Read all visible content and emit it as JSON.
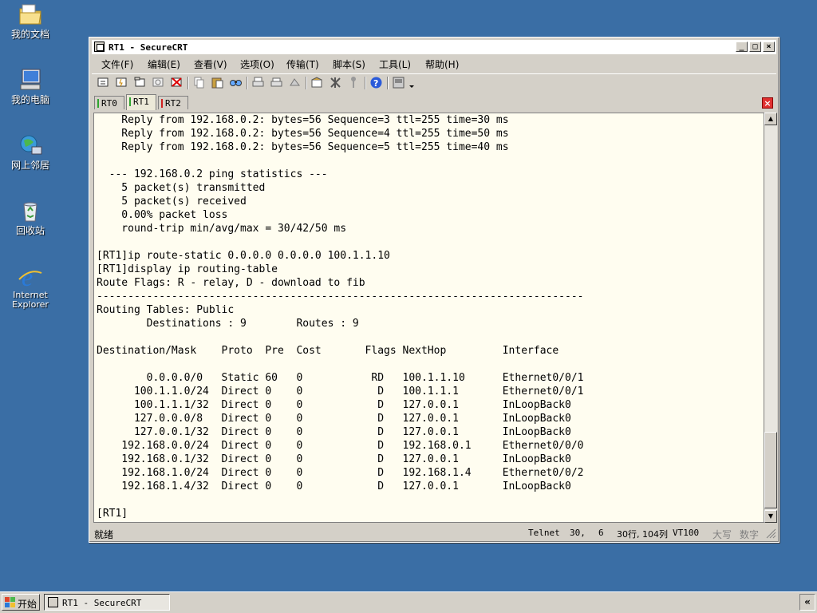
{
  "desktop": {
    "icons": [
      {
        "label": "我的文档"
      },
      {
        "label": "我的电脑"
      },
      {
        "label": "网上邻居"
      },
      {
        "label": "回收站"
      },
      {
        "label": "Internet Explorer"
      }
    ]
  },
  "window": {
    "title": "RT1 - SecureCRT",
    "menu": [
      "文件(F)",
      "编辑(E)",
      "查看(V)",
      "选项(O)",
      "传输(T)",
      "脚本(S)",
      "工具(L)",
      "帮助(H)"
    ],
    "tabs": [
      {
        "label": "RT0",
        "color": "#2fa52f"
      },
      {
        "label": "RT1",
        "color": "#2fa52f"
      },
      {
        "label": "RT2",
        "color": "#d02020"
      }
    ],
    "active_tab": "RT1",
    "terminal_lines": [
      "    Reply from 192.168.0.2: bytes=56 Sequence=3 ttl=255 time=30 ms",
      "    Reply from 192.168.0.2: bytes=56 Sequence=4 ttl=255 time=50 ms",
      "    Reply from 192.168.0.2: bytes=56 Sequence=5 ttl=255 time=40 ms",
      "",
      "  --- 192.168.0.2 ping statistics ---",
      "    5 packet(s) transmitted",
      "    5 packet(s) received",
      "    0.00% packet loss",
      "    round-trip min/avg/max = 30/42/50 ms",
      "",
      "[RT1]ip route-static 0.0.0.0 0.0.0.0 100.1.1.10",
      "[RT1]display ip routing-table",
      "Route Flags: R - relay, D - download to fib",
      "------------------------------------------------------------------------------",
      "Routing Tables: Public",
      "        Destinations : 9        Routes : 9",
      "",
      "Destination/Mask    Proto  Pre  Cost       Flags NextHop         Interface",
      "",
      "        0.0.0.0/0   Static 60   0           RD   100.1.1.10      Ethernet0/0/1",
      "      100.1.1.0/24  Direct 0    0            D   100.1.1.1       Ethernet0/0/1",
      "      100.1.1.1/32  Direct 0    0            D   127.0.0.1       InLoopBack0",
      "      127.0.0.0/8   Direct 0    0            D   127.0.0.1       InLoopBack0",
      "      127.0.0.1/32  Direct 0    0            D   127.0.0.1       InLoopBack0",
      "    192.168.0.0/24  Direct 0    0            D   192.168.0.1     Ethernet0/0/0",
      "    192.168.0.1/32  Direct 0    0            D   127.0.0.1       InLoopBack0",
      "    192.168.1.0/24  Direct 0    0            D   192.168.1.4     Ethernet0/0/2",
      "    192.168.1.4/32  Direct 0    0            D   127.0.0.1       InLoopBack0",
      "",
      "[RT1]"
    ],
    "status": {
      "ready": "就绪",
      "protocol": "Telnet",
      "row": "30,",
      "col": "6",
      "size": "30行, 104列",
      "term": "VT100",
      "caps": "大写",
      "num": "数字"
    }
  },
  "taskbar": {
    "start_label": "开始",
    "task_label": "RT1 - SecureCRT",
    "tray_label": "«"
  }
}
